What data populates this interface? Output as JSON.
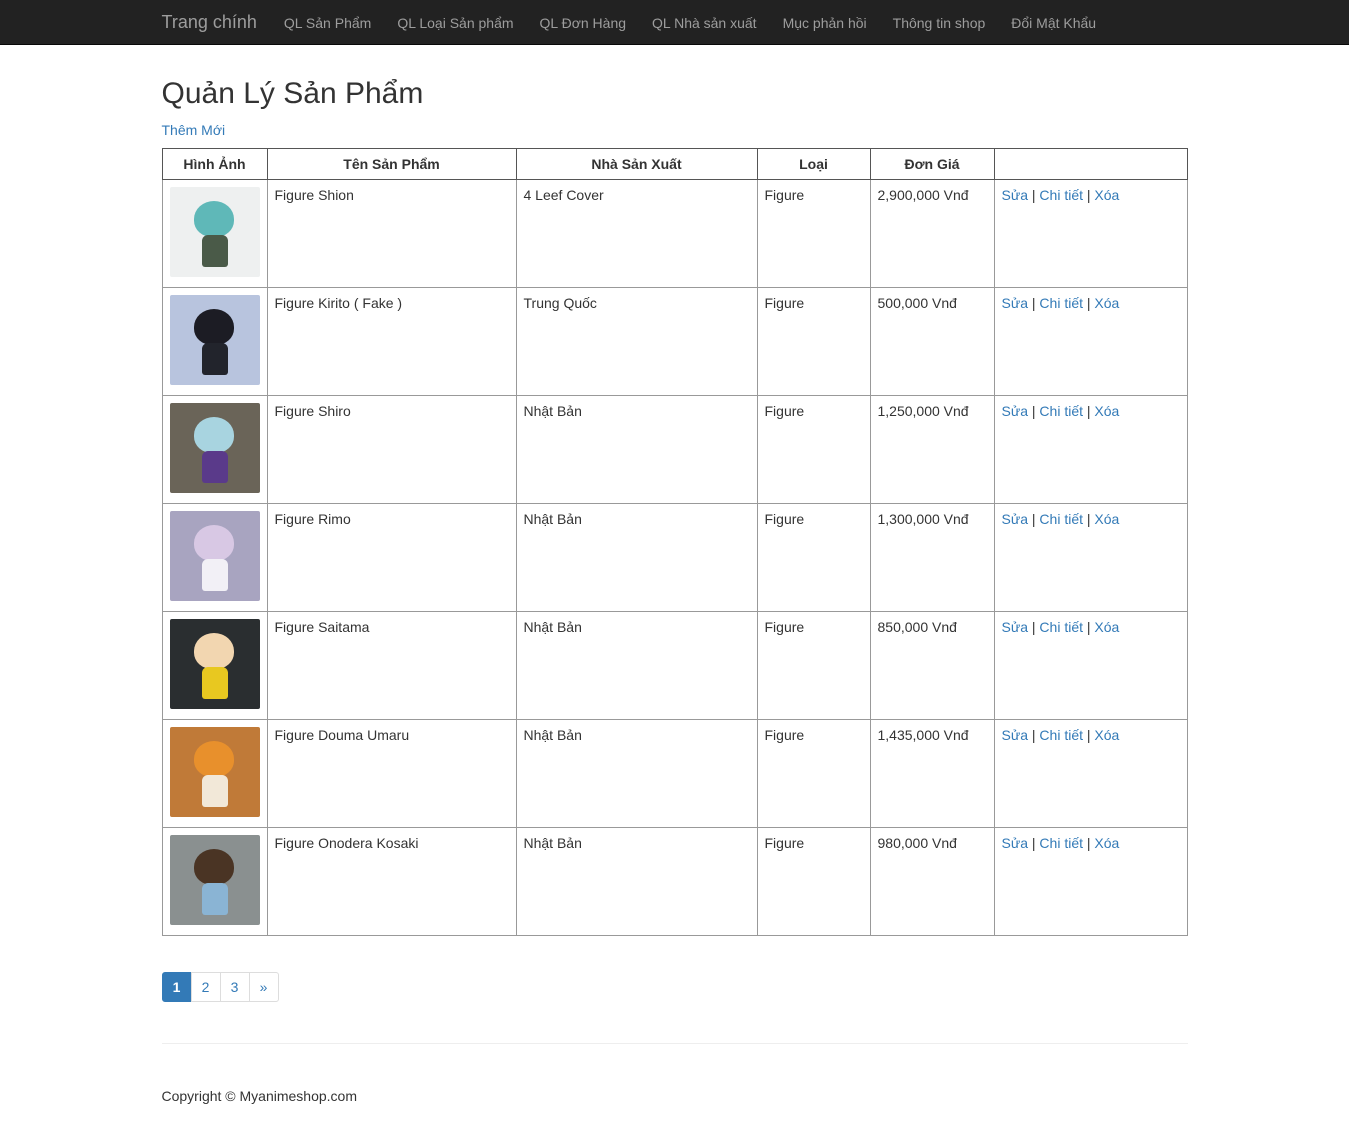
{
  "navbar": {
    "brand": "Trang chính",
    "items": [
      {
        "label": "QL Sản Phẩm"
      },
      {
        "label": "QL Loại Sản phẩm"
      },
      {
        "label": "QL Đơn Hàng"
      },
      {
        "label": "QL Nhà sản xuất"
      },
      {
        "label": "Mục phản hồi"
      },
      {
        "label": "Thông tin shop"
      },
      {
        "label": "Đổi Mật Khẩu"
      }
    ]
  },
  "page": {
    "title": "Quản Lý Sản Phẩm",
    "add_new": "Thêm Mới"
  },
  "table": {
    "headers": [
      "Hình Ảnh",
      "Tên Sản Phẩm",
      "Nhà Sản Xuất",
      "Loại",
      "Đơn Giá",
      ""
    ],
    "action_labels": {
      "edit": "Sửa",
      "details": "Chi tiết",
      "delete": "Xóa",
      "sep": "|"
    },
    "rows": [
      {
        "name": "Figure Shion",
        "maker": "4 Leef Cover",
        "type": "Figure",
        "price": "2,900,000 Vnđ",
        "bg": "#eef0f0",
        "hair": "#5fb8b8",
        "outfit": "#4a5a48"
      },
      {
        "name": "Figure Kirito ( Fake )",
        "maker": "Trung Quốc",
        "type": "Figure",
        "price": "500,000 Vnđ",
        "bg": "#b8c4de",
        "hair": "#1c1c24",
        "outfit": "#22242c"
      },
      {
        "name": "Figure Shiro",
        "maker": "Nhật Bản",
        "type": "Figure",
        "price": "1,250,000 Vnđ",
        "bg": "#6a6458",
        "hair": "#a8d4e0",
        "outfit": "#5a3a8a"
      },
      {
        "name": "Figure Rimo",
        "maker": "Nhật Bản",
        "type": "Figure",
        "price": "1,300,000 Vnđ",
        "bg": "#a8a4c0",
        "hair": "#d8c8e4",
        "outfit": "#f2f0f6"
      },
      {
        "name": "Figure Saitama",
        "maker": "Nhật Bản",
        "type": "Figure",
        "price": "850,000 Vnđ",
        "bg": "#2a2e30",
        "hair": "#f2d6b0",
        "outfit": "#e8c820"
      },
      {
        "name": "Figure Douma Umaru",
        "maker": "Nhật Bản",
        "type": "Figure",
        "price": "1,435,000 Vnđ",
        "bg": "#c07a38",
        "hair": "#e8902c",
        "outfit": "#f2e8d8"
      },
      {
        "name": "Figure Onodera Kosaki",
        "maker": "Nhật Bản",
        "type": "Figure",
        "price": "980,000 Vnđ",
        "bg": "#8a9090",
        "hair": "#4a3424",
        "outfit": "#8ab4d4"
      }
    ]
  },
  "pagination": {
    "pages": [
      "1",
      "2",
      "3"
    ],
    "next": "»",
    "active": "1"
  },
  "footer": {
    "copyright": "Copyright © Myanimeshop.com"
  }
}
